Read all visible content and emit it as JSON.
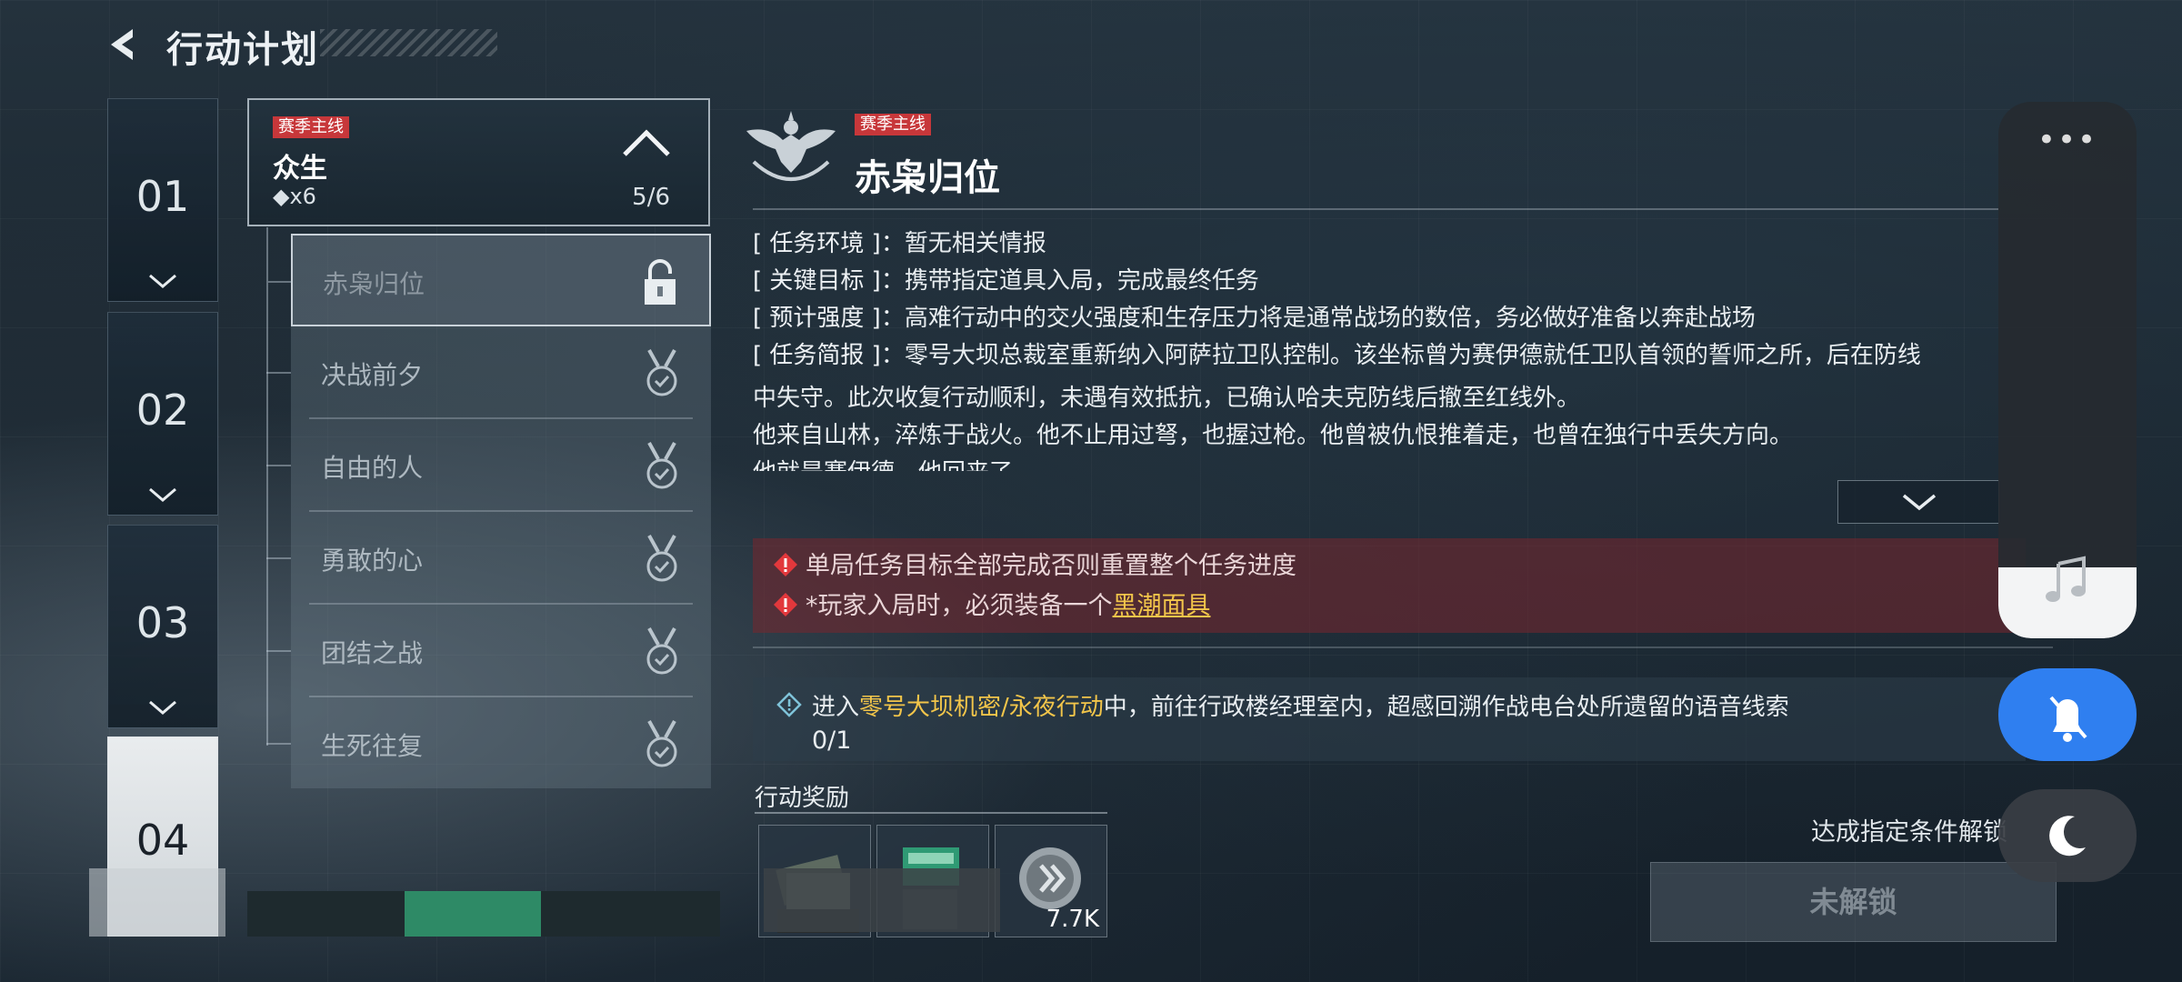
{
  "header": {
    "title": "行动计划"
  },
  "chapters": [
    "01",
    "02",
    "03",
    "04"
  ],
  "mission_group": {
    "tag": "赛季主线",
    "name": "众生",
    "count": "◆x6",
    "progress": "5/6"
  },
  "missions": [
    {
      "label": "赤枭归位",
      "status": "locked"
    },
    {
      "label": "决战前夕",
      "status": "completed"
    },
    {
      "label": "自由的人",
      "status": "completed"
    },
    {
      "label": "勇敢的心",
      "status": "completed"
    },
    {
      "label": "团结之战",
      "status": "completed"
    },
    {
      "label": "生死往复",
      "status": "completed"
    }
  ],
  "detail": {
    "tag": "赛季主线",
    "title": "赤枭归位",
    "info": [
      {
        "key": "[ 任务环境 ]：",
        "value": "暂无相关情报"
      },
      {
        "key": "[ 关键目标 ]：",
        "value": "携带指定道具入局，完成最终任务"
      },
      {
        "key": "[ 预计强度 ]：",
        "value": "高难行动中的交火强度和生存压力将是通常战场的数倍，务必做好准备以奔赴战场"
      },
      {
        "key": "[ 任务简报 ]：",
        "value": "零号大坝总裁室重新纳入阿萨拉卫队控制。该坐标曾为赛伊德就任卫队首领的誓师之所，后在防线"
      }
    ],
    "description": [
      "中失守。此次收复行动顺利，未遇有效抵抗，已确认哈夫克防线后撤至红线外。",
      "他来自山林，淬炼于战火。他不止用过弩，也握过枪。他曾被仇恨推着走，也曾在独行中丢失方向。",
      "他就是赛伊德，他回来了。"
    ]
  },
  "warnings": {
    "line1": "单局任务目标全部完成否则重置整个任务进度",
    "line2_prefix": "*玩家入局时，必须装备一个",
    "line2_highlight": "黑潮面具"
  },
  "task": {
    "prefix": "进入",
    "highlight": "零号大坝机密/永夜行动",
    "suffix": "中，前往行政楼经理室内，超感回溯作战电台处所遗留的语音线索",
    "progress": "0/1"
  },
  "rewards": {
    "title": "行动奖励",
    "items": [
      {
        "icon": "cash-stack-icon"
      },
      {
        "icon": "ammo-box-icon"
      },
      {
        "icon": "coin-icon",
        "amount": "7.7K"
      }
    ]
  },
  "unlock": {
    "hint": "达成指定条件解锁",
    "button": "未解锁"
  },
  "colors": {
    "accent_red": "#c7373a",
    "highlight_yellow": "#f2c54a",
    "toggle_blue": "#2f7ff0"
  }
}
